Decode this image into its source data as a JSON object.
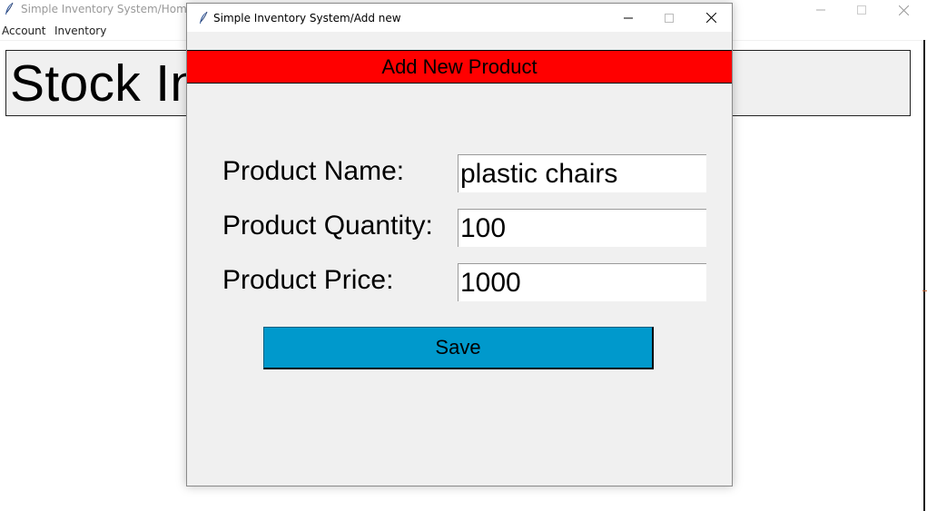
{
  "main_window": {
    "title": "Simple Inventory System/Home",
    "menu": [
      {
        "label": "Account"
      },
      {
        "label": "Inventory"
      }
    ],
    "banner_text": "Stock Inventory System"
  },
  "dialog": {
    "title": "Simple Inventory System/Add new",
    "header": "Add New Product",
    "fields": {
      "name": {
        "label": "Product Name:",
        "value": "plastic chairs"
      },
      "quantity": {
        "label": "Product Quantity:",
        "value": "100"
      },
      "price": {
        "label": "Product Price:",
        "value": "1000"
      }
    },
    "save_label": "Save"
  },
  "colors": {
    "header_bg": "#ff0000",
    "save_bg": "#0099cc",
    "window_bg": "#f0f0f0"
  },
  "icons": [
    "feather-app-icon",
    "minimize-icon",
    "maximize-icon",
    "close-icon"
  ]
}
